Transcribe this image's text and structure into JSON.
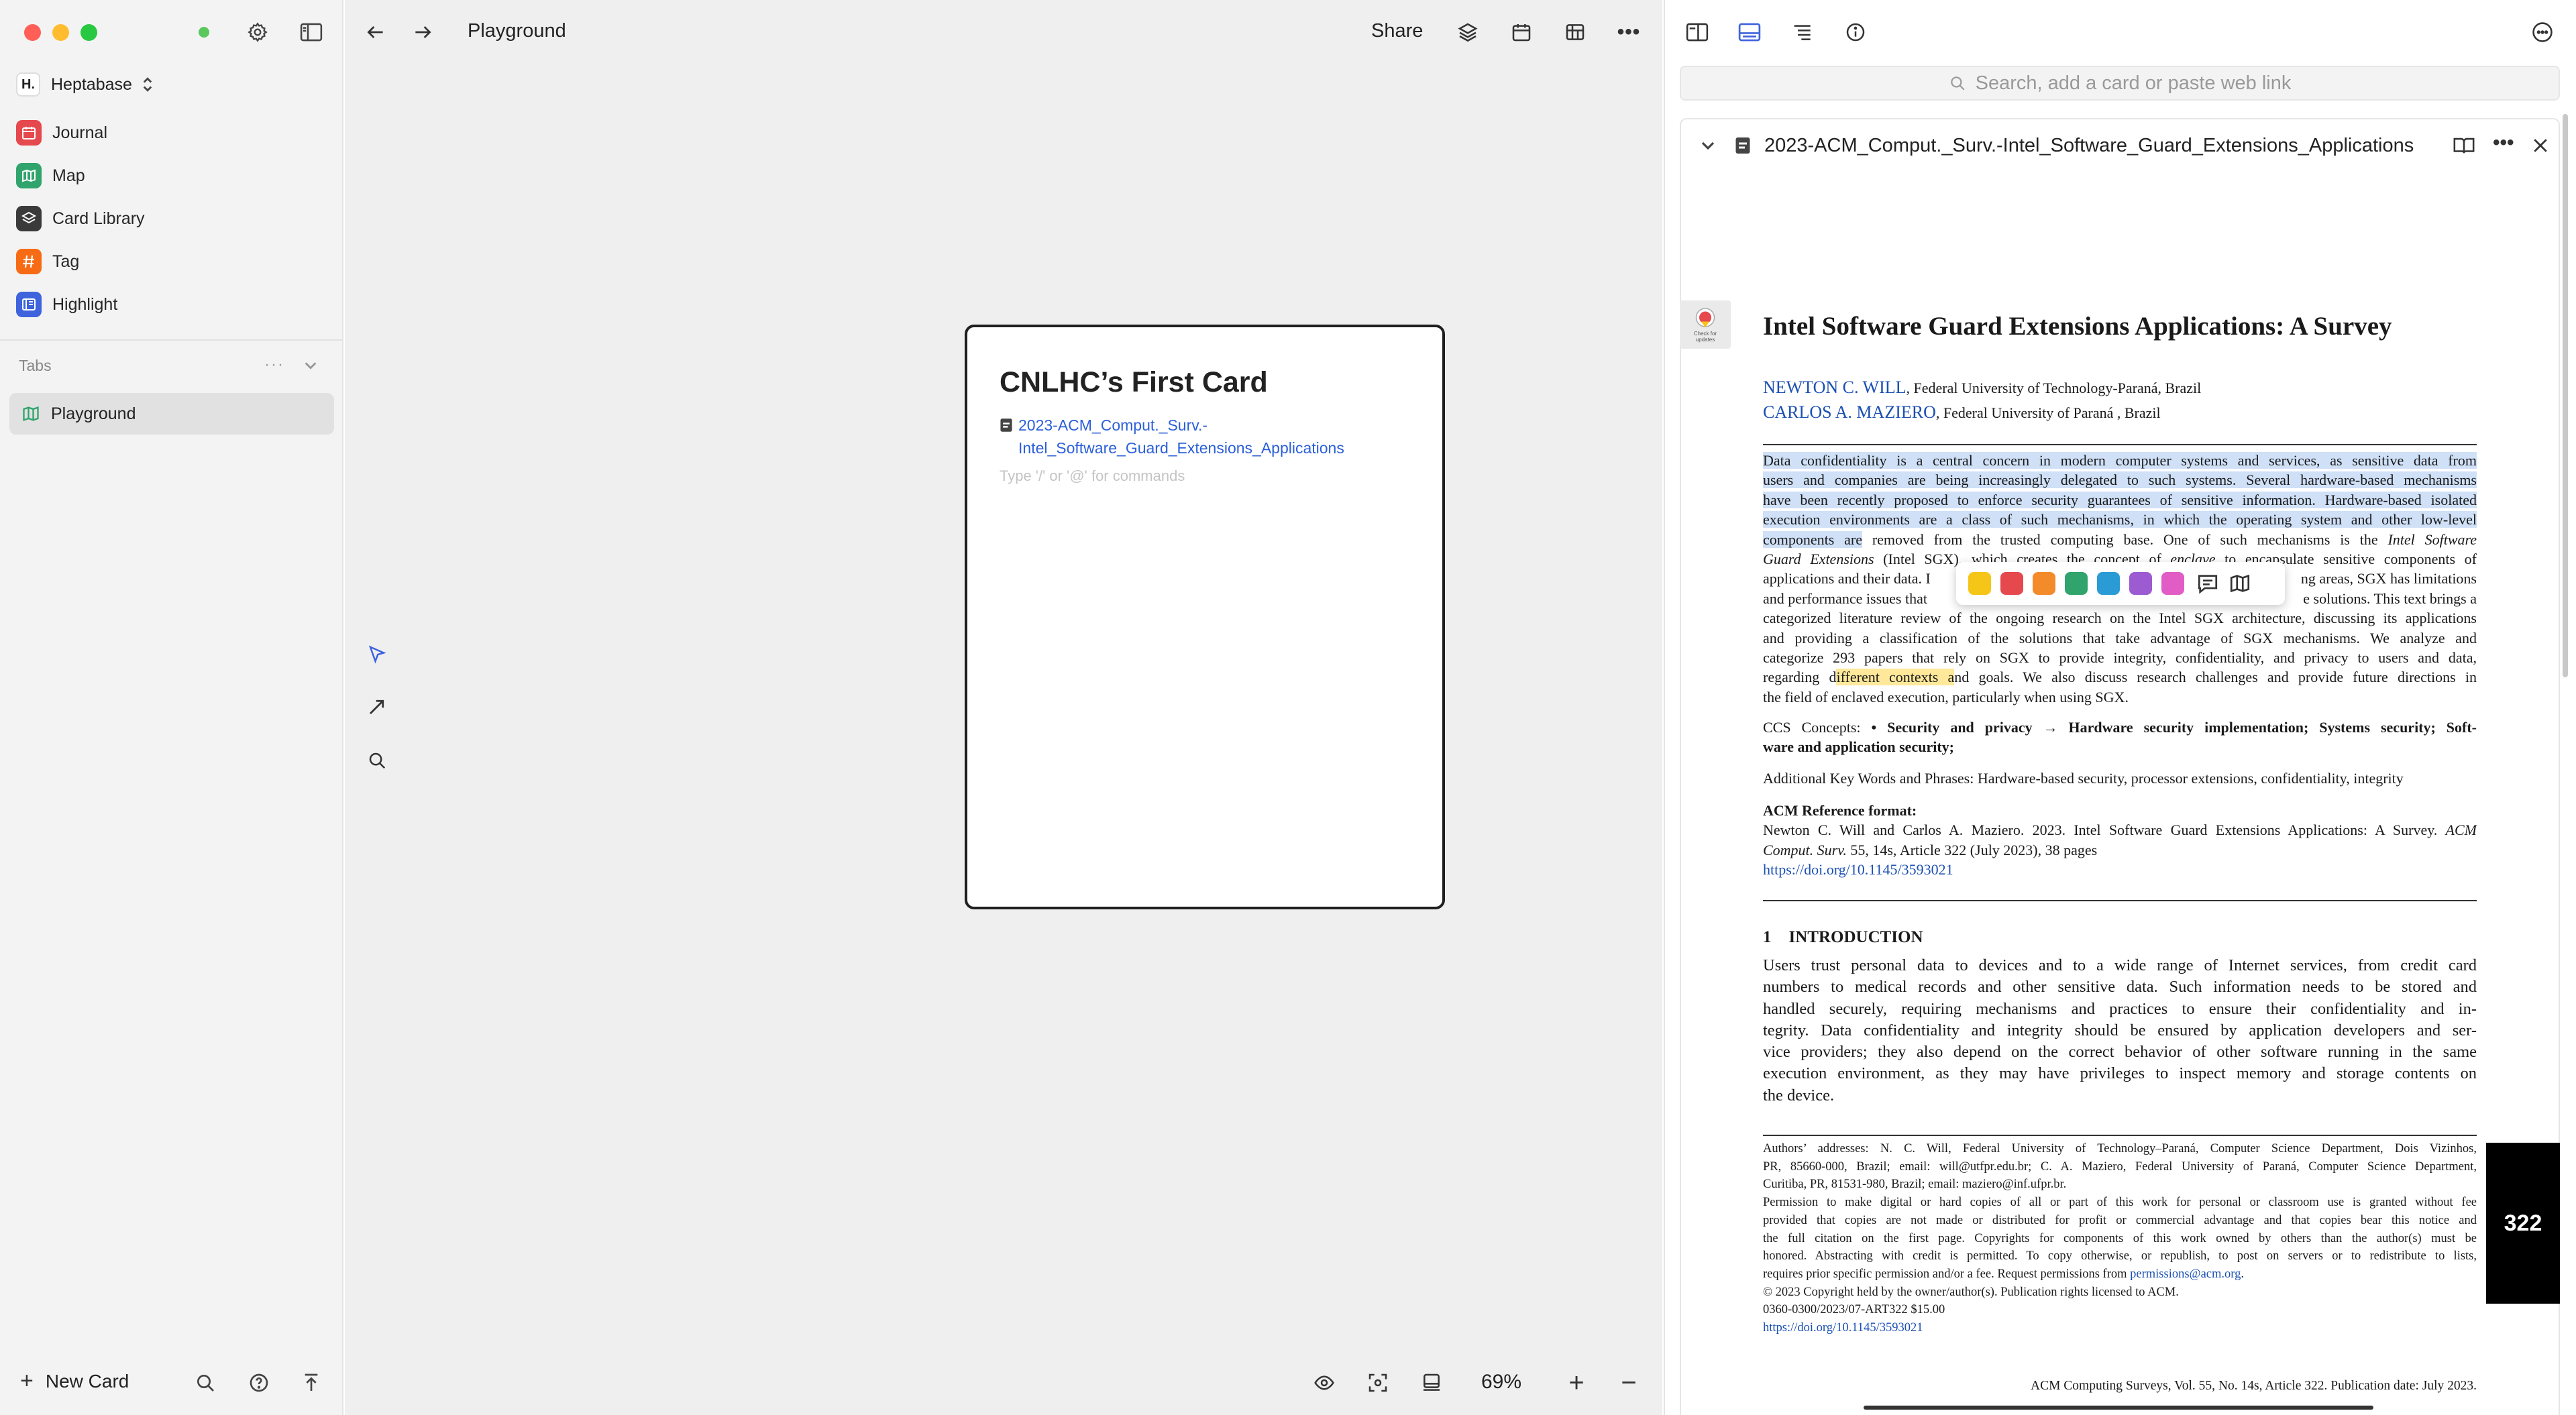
{
  "sidebar": {
    "workspace": {
      "badge": "H.",
      "name": "Heptabase"
    },
    "items": [
      {
        "label": "Journal",
        "icon": "calendar-icon",
        "color": "#e5484d"
      },
      {
        "label": "Map",
        "icon": "map-icon",
        "color": "#30a46c"
      },
      {
        "label": "Card Library",
        "icon": "layers-icon",
        "color": "#3a3a3a"
      },
      {
        "label": "Tag",
        "icon": "hash-icon",
        "color": "#f76b15"
      },
      {
        "label": "Highlight",
        "icon": "highlight-icon",
        "color": "#3e63dd"
      }
    ],
    "tabs_header": "Tabs",
    "tabs": [
      {
        "label": "Playground",
        "icon": "map-icon"
      }
    ],
    "new_card": "New Card"
  },
  "toolbar": {
    "title": "Playground",
    "share": "Share"
  },
  "card": {
    "title": "CNLHC’s First Card",
    "link_line1": "2023-ACM_Comput._Surv.-",
    "link_line2": "Intel_Software_Guard_Extensions_Applications",
    "placeholder": "Type '/' or '@' for commands"
  },
  "zoom": "69%",
  "panel": {
    "search_placeholder": "Search, add a card or paste web link",
    "doc_title": "2023-ACM_Comput._Surv.-Intel_Software_Guard_Extensions_Applications"
  },
  "pdf": {
    "badge": "Check for updates",
    "title": "Intel Software Guard Extensions Applications: A Survey",
    "author1": "NEWTON C. WILL",
    "affil1": ", Federal University of Technology-Paraná, Brazil",
    "author2": "CARLOS A. MAZIERO",
    "affil2": ", Federal University of Paraná , Brazil",
    "abs_l1": "Data confidentiality is a central concern in modern computer systems and services, as sensitive data from",
    "abs_l2": "users and companies are being increasingly delegated to such systems. Several hardware-based mechanisms",
    "abs_l3": "have been recently proposed to enforce security guarantees of sensitive information. Hardware-based isolated",
    "abs_l4": "execution environments are a class of such mechanisms, in which the operating system and other low-level",
    "abs_l5a": "components are",
    "abs_l5b": " removed from the trusted computing base. One of such mechanisms is the ",
    "abs_l5c": "Intel Software",
    "abs_l6a": "Guard Extensions",
    "abs_l6b": " (Intel SGX), which creates the concept of ",
    "abs_l6c": "enclave",
    "abs_l6d": " to encapsulate sensitive components of",
    "abs_l7a": "applications and their data. I",
    "abs_l7b": "ng areas, SGX has limitations",
    "abs_l8a": "and performance issues that",
    "abs_l8b": "e solutions. This text brings a",
    "abs_l9": "categorized literature review of the ongoing research on the Intel SGX architecture, discussing its applications",
    "abs_l10": "and providing a classification of the solutions that take advantage of SGX mechanisms. We analyze and",
    "abs_l11": "categorize 293 papers that rely on SGX to provide integrity, confidentiality, and privacy to users and data,",
    "abs_l12a": "regarding d",
    "abs_l12b": "ifferent contexts a",
    "abs_l12c": "nd goals. We also discuss research challenges and provide future directions in",
    "abs_l13": "the field of enclaved execution, particularly when using SGX.",
    "ccs_label": "CCS Concepts:",
    "ccs_l1": "• Security and privacy → Hardware security implementation; Systems security; Soft-",
    "ccs_l2": "ware and application security;",
    "keywords": "Additional Key Words and Phrases: Hardware-based security, processor extensions, confidentiality, integrity",
    "ref_head": "ACM Reference format:",
    "ref_l1a": "Newton C. Will and Carlos A. Maziero. 2023. Intel Software Guard Extensions Applications: A Survey. ",
    "ref_l1b": "ACM",
    "ref_l2a": "Comput. Surv.",
    "ref_l2b": " 55, 14s, Article 322 (July 2023), 38 pages",
    "doi": "https://doi.org/10.1145/3593021",
    "sec_num": "1",
    "sec_title": "INTRODUCTION",
    "intro_l1": "Users trust personal data to devices and to a wide range of Internet services, from credit card",
    "intro_l2": "numbers to medical records and other sensitive data. Such information needs to be stored and",
    "intro_l3": "handled securely, requiring mechanisms and practices to ensure their confidentiality and in-",
    "intro_l4": "tegrity. Data confidentiality and integrity should be ensured by application developers and ser-",
    "intro_l5": "vice providers; they also depend on the correct behavior of other software running in the same",
    "intro_l6": "execution environment, as they may have privileges to inspect memory and storage contents on",
    "intro_l7": "the device.",
    "fn_l1": "Authors’ addresses: N. C. Will, Federal University of Technology–Paraná, Computer Science Department, Dois Vizinhos,",
    "fn_l2": "PR, 85660-000, Brazil; email: will@utfpr.edu.br; C. A. Maziero, Federal University of Paraná, Computer Science Department,",
    "fn_l3": "Curitiba, PR, 81531-980, Brazil; email: maziero@inf.ufpr.br.",
    "fn_l4": "Permission to make digital or hard copies of all or part of this work for personal or classroom use is granted without fee",
    "fn_l5": "provided that copies are not made or distributed for profit or commercial advantage and that copies bear this notice and",
    "fn_l6": "the full citation on the first page. Copyrights for components of this work owned by others than the author(s) must be",
    "fn_l7": "honored. Abstracting with credit is permitted. To copy otherwise, or republish, to post on servers or to redistribute to lists,",
    "fn_l8a": "requires prior specific permission and/or a fee. Request permissions from ",
    "fn_l8b": "permissions@acm.org",
    "fn_l8c": ".",
    "fn_l9": "© 2023 Copyright held by the owner/author(s). Publication rights licensed to ACM.",
    "fn_l10": "0360-0300/2023/07-ART322 $15.00",
    "fn_doi": "https://doi.org/10.1145/3593021",
    "page_tab": "322",
    "footer": "ACM Computing Surveys, Vol. 55, No. 14s, Article 322. Publication date: July 2023."
  },
  "highlight_colors": [
    "#f5c518",
    "#e5484d",
    "#f38b2a",
    "#30a46c",
    "#2b9bd6",
    "#9d5bd2",
    "#e15dc5"
  ]
}
